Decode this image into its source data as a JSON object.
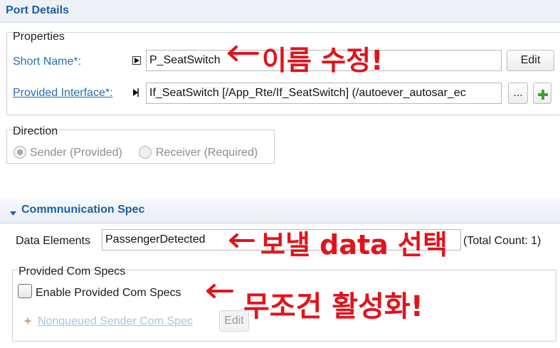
{
  "header": {
    "title": "Port Details"
  },
  "properties": {
    "group_label": "Properties",
    "short_name_label": "Short Name*:",
    "short_name_value": "P_SeatSwitch",
    "edit_label": "Edit",
    "provided_interface_label": "Provided Interface*:",
    "provided_interface_value": "If_SeatSwitch [/App_Rte/If_SeatSwitch] (/autoever_autosar_ec",
    "browse_label": "...",
    "add_label": "+"
  },
  "direction": {
    "group_label": "Direction",
    "options": [
      {
        "label": "Sender (Provided)",
        "selected": true
      },
      {
        "label": "Receiver (Required)",
        "selected": false
      }
    ]
  },
  "comm_spec": {
    "title": "Commnunication Spec",
    "data_elements_label": "Data Elements",
    "data_elements_value": "PassengerDetected",
    "total_count": "(Total Count: 1)",
    "provided_com_specs": {
      "group_label": "Provided Com Specs",
      "enable_label": "Enable Provided Com Specs",
      "enabled": false,
      "nonqueued_link": "Nonqueued Sender Com Spec",
      "edit_label": "Edit"
    }
  },
  "annotations": [
    {
      "id": "rename",
      "text": "이름 수정!"
    },
    {
      "id": "select-data",
      "text": "보낼 data 선택"
    },
    {
      "id": "activate",
      "text": "무조건 활성화!"
    }
  ],
  "colors": {
    "accent": "#1d5fa8",
    "link": "#2c6cb4",
    "annotation": "#e3121b"
  }
}
